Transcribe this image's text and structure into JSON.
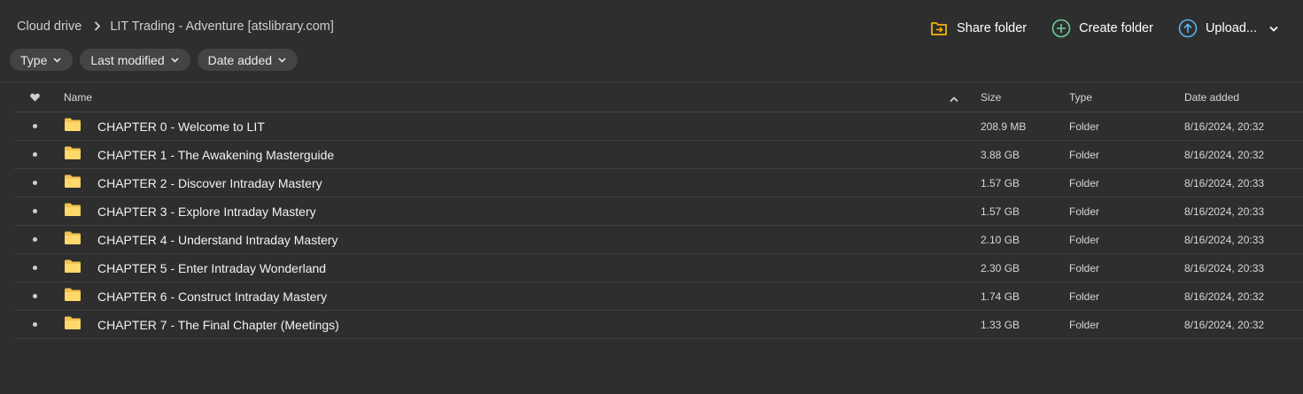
{
  "breadcrumb": {
    "root": "Cloud drive",
    "current": "LIT Trading - Adventure [atslibrary.com]"
  },
  "actions": {
    "share": "Share folder",
    "create": "Create folder",
    "upload": "Upload..."
  },
  "filters": {
    "type": "Type",
    "last_modified": "Last modified",
    "date_added": "Date added"
  },
  "table": {
    "headers": {
      "name": "Name",
      "size": "Size",
      "type": "Type",
      "date_added": "Date added"
    },
    "rows": [
      {
        "name": "CHAPTER 0 - Welcome to LIT",
        "size": "208.9 MB",
        "type": "Folder",
        "date": "8/16/2024, 20:32"
      },
      {
        "name": "CHAPTER 1 - The Awakening Masterguide",
        "size": "3.88 GB",
        "type": "Folder",
        "date": "8/16/2024, 20:32"
      },
      {
        "name": "CHAPTER 2 - Discover Intraday Mastery",
        "size": "1.57 GB",
        "type": "Folder",
        "date": "8/16/2024, 20:33"
      },
      {
        "name": "CHAPTER 3 - Explore Intraday Mastery",
        "size": "1.57 GB",
        "type": "Folder",
        "date": "8/16/2024, 20:33"
      },
      {
        "name": "CHAPTER 4 - Understand Intraday Mastery",
        "size": "2.10 GB",
        "type": "Folder",
        "date": "8/16/2024, 20:33"
      },
      {
        "name": "CHAPTER 5 - Enter Intraday Wonderland",
        "size": "2.30 GB",
        "type": "Folder",
        "date": "8/16/2024, 20:33"
      },
      {
        "name": "CHAPTER 6 - Construct Intraday Mastery",
        "size": "1.74 GB",
        "type": "Folder",
        "date": "8/16/2024, 20:32"
      },
      {
        "name": "CHAPTER 7 - The Final Chapter (Meetings)",
        "size": "1.33 GB",
        "type": "Folder",
        "date": "8/16/2024, 20:32"
      }
    ]
  },
  "icons": {
    "share": "share-folder-icon",
    "create": "plus-circle-icon",
    "upload": "upload-arrow-icon",
    "folder": "folder-icon",
    "favourite_header": "heart-icon"
  },
  "colors": {
    "background": "#2e2e2e",
    "share_icon": "#f0b400",
    "create_icon": "#6fcf97",
    "upload_icon": "#5ab4f0",
    "folder": "#ffd86b"
  }
}
